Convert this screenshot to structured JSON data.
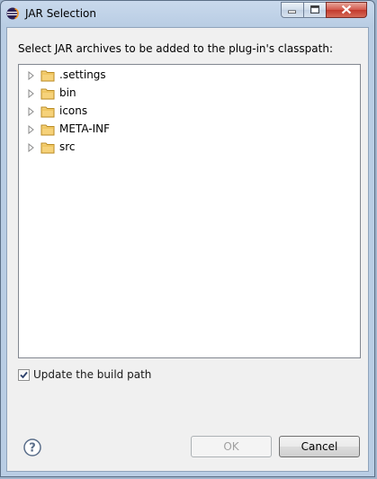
{
  "window": {
    "title": "JAR Selection"
  },
  "dialog": {
    "prompt": "Select JAR archives to be added to the plug-in's classpath:",
    "tree_items": [
      {
        "label": ".settings",
        "icon": "folder-icon"
      },
      {
        "label": "bin",
        "icon": "folder-icon"
      },
      {
        "label": "icons",
        "icon": "folder-icon"
      },
      {
        "label": "META-INF",
        "icon": "folder-icon"
      },
      {
        "label": "src",
        "icon": "folder-icon"
      }
    ],
    "update_build_path": {
      "label": "Update the build path",
      "checked": true
    },
    "ok_label": "OK",
    "ok_enabled": false,
    "cancel_label": "Cancel"
  },
  "colors": {
    "folder": "#e8b94a",
    "titlebar": "#b9cde4",
    "close": "#c23a2c"
  }
}
